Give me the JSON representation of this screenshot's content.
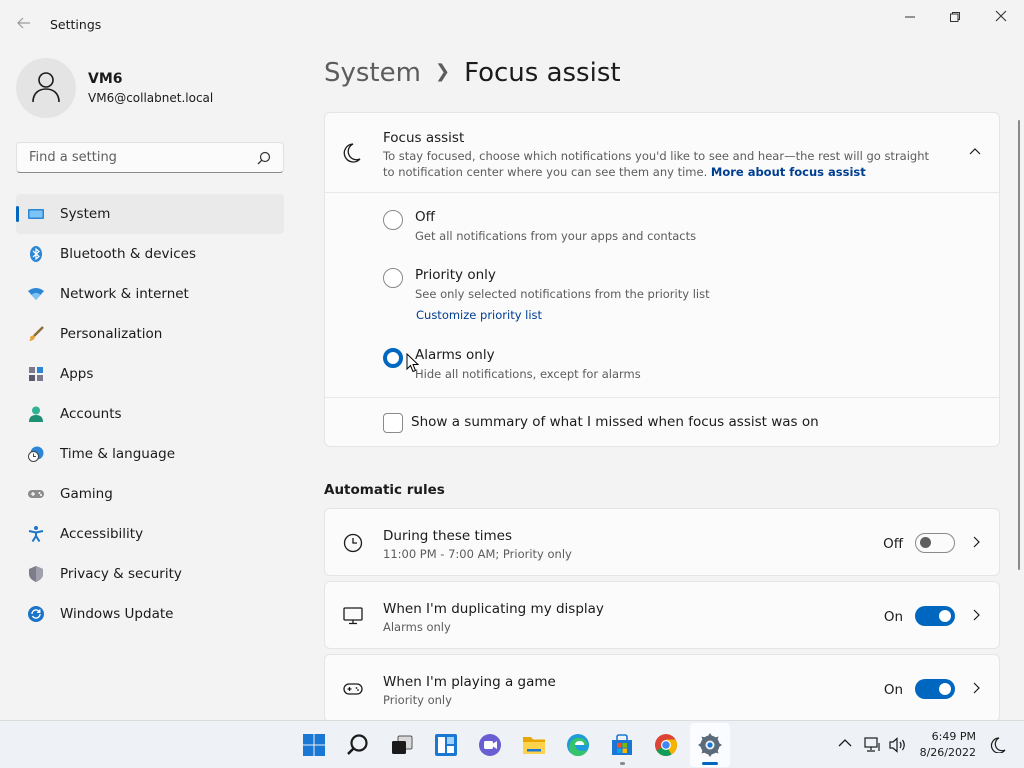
{
  "window": {
    "title": "Settings"
  },
  "user": {
    "name": "VM6",
    "email": "VM6@collabnet.local"
  },
  "search": {
    "placeholder": "Find a setting"
  },
  "nav": [
    {
      "label": "System",
      "icon": "monitor-icon",
      "active": true
    },
    {
      "label": "Bluetooth & devices",
      "icon": "bluetooth-icon"
    },
    {
      "label": "Network & internet",
      "icon": "wifi-icon"
    },
    {
      "label": "Personalization",
      "icon": "brush-icon"
    },
    {
      "label": "Apps",
      "icon": "apps-icon"
    },
    {
      "label": "Accounts",
      "icon": "person-icon"
    },
    {
      "label": "Time & language",
      "icon": "clock-globe-icon"
    },
    {
      "label": "Gaming",
      "icon": "gamepad-icon"
    },
    {
      "label": "Accessibility",
      "icon": "accessibility-icon"
    },
    {
      "label": "Privacy & security",
      "icon": "shield-icon"
    },
    {
      "label": "Windows Update",
      "icon": "update-icon"
    }
  ],
  "breadcrumb": {
    "parent": "System",
    "current": "Focus assist"
  },
  "focus_assist": {
    "title": "Focus assist",
    "description": "To stay focused, choose which notifications you'd like to see and hear—the rest will go straight to notification center where you can see them any time.",
    "link": "More about focus assist",
    "options": [
      {
        "label": "Off",
        "sub": "Get all notifications from your apps and contacts",
        "selected": false
      },
      {
        "label": "Priority only",
        "sub": "See only selected notifications from the priority list",
        "link": "Customize priority list",
        "selected": false
      },
      {
        "label": "Alarms only",
        "sub": "Hide all notifications, except for alarms",
        "selected": true
      }
    ],
    "summary_checkbox": "Show a summary of what I missed when focus assist was on"
  },
  "automatic_rules": {
    "heading": "Automatic rules",
    "rules": [
      {
        "title": "During these times",
        "sub": "11:00 PM - 7:00 AM; Priority only",
        "state": "Off",
        "on": false,
        "icon": "clock-icon"
      },
      {
        "title": "When I'm duplicating my display",
        "sub": "Alarms only",
        "state": "On",
        "on": true,
        "icon": "display-icon"
      },
      {
        "title": "When I'm playing a game",
        "sub": "Priority only",
        "state": "On",
        "on": true,
        "icon": "gamepad-icon"
      }
    ]
  },
  "taskbar": {
    "time": "6:49 PM",
    "date": "8/26/2022",
    "apps": [
      "start-icon",
      "search-icon",
      "task-view-icon",
      "widgets-icon",
      "chat-icon",
      "file-explorer-icon",
      "edge-icon",
      "store-icon",
      "chrome-icon",
      "settings-icon"
    ]
  },
  "colors": {
    "accent": "#0067c0",
    "link": "#003e92",
    "background": "#f3f3f3",
    "card": "#fbfbfb"
  }
}
